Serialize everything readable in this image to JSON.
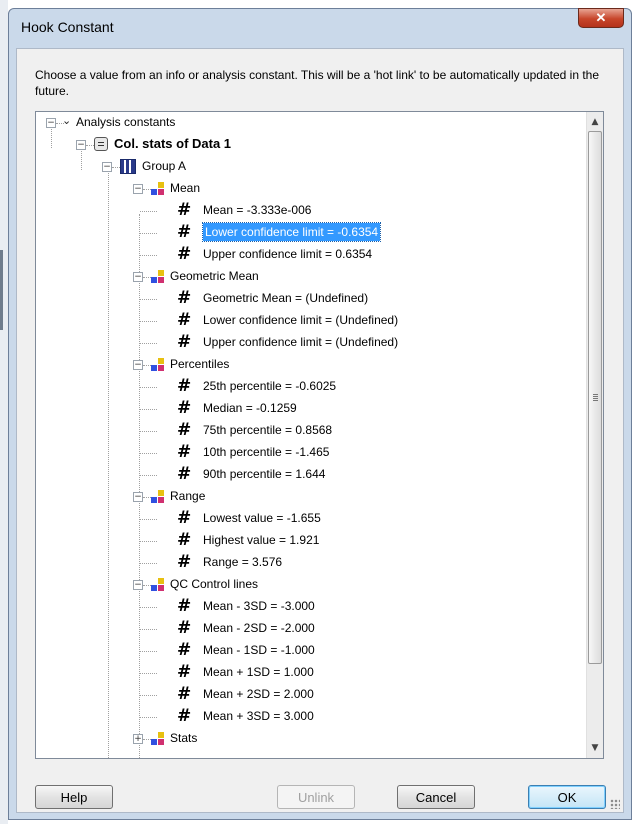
{
  "dialog": {
    "title": "Hook Constant",
    "close_icon": "close-icon",
    "description": "Choose a value from an info or analysis constant. This will be a 'hot link' to be automatically updated in the future."
  },
  "tree": {
    "root_label": "Analysis constants",
    "results_label": "Col. stats of Data 1",
    "group_label": "Group A",
    "mean": {
      "label": "Mean",
      "items": [
        "Mean = -3.333e-006",
        "Lower confidence limit = -0.6354",
        "Upper confidence limit = 0.6354"
      ]
    },
    "geomean": {
      "label": "Geometric Mean",
      "items": [
        "Geometric Mean = (Undefined)",
        "Lower confidence limit = (Undefined)",
        "Upper confidence limit = (Undefined)"
      ]
    },
    "percentiles": {
      "label": "Percentiles",
      "items": [
        "25th percentile = -0.6025",
        "Median = -0.1259",
        "75th percentile = 0.8568",
        "10th percentile = -1.465",
        "90th percentile = 1.644"
      ]
    },
    "range": {
      "label": "Range",
      "items": [
        "Lowest value = -1.655",
        "Highest value = 1.921",
        "Range = 3.576"
      ]
    },
    "qc": {
      "label": "QC Control lines",
      "items": [
        "Mean - 3SD = -3.000",
        "Mean - 2SD = -2.000",
        "Mean - 1SD = -1.000",
        "Mean + 1SD = 1.000",
        "Mean + 2SD = 2.000",
        "Mean + 3SD = 3.000"
      ]
    },
    "stats_label": "Stats",
    "selected_item": "Lower confidence limit = -0.6354",
    "hash_glyph": "#",
    "expanded_glyph": "⊟",
    "collapsed_glyph": "⊞",
    "selection_color": "#3399ff"
  },
  "buttons": {
    "help": "Help",
    "unlink": "Unlink",
    "cancel": "Cancel",
    "ok": "OK"
  }
}
